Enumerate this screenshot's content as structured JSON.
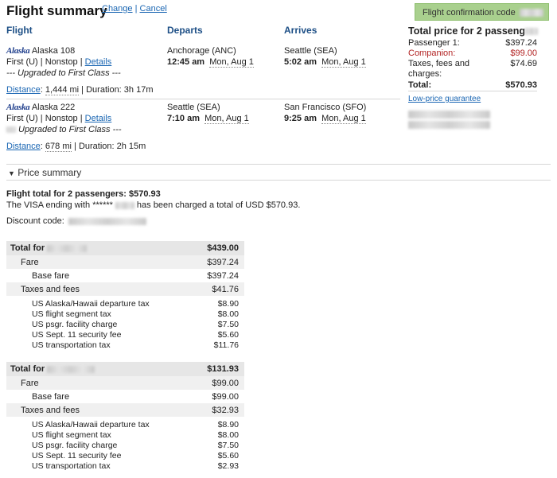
{
  "header": {
    "title": "Flight summary",
    "change": "Change",
    "sep": "|",
    "cancel": "Cancel",
    "confirmation_label": "Flight confirmation code"
  },
  "columns": {
    "flight": "Flight",
    "departs": "Departs",
    "arrives": "Arrives"
  },
  "segments": [
    {
      "logo": "Alaska",
      "flight": "Alaska 108",
      "cabin": "First (U)",
      "stops": "Nonstop",
      "details": "Details",
      "upgrade": "--- Upgraded to First Class ---",
      "dep_city": "Anchorage (ANC)",
      "dep_time": "12:45 am",
      "dep_date": "Mon, Aug 1",
      "arr_city": "Seattle (SEA)",
      "arr_time": "5:02 am",
      "arr_date": "Mon, Aug 1",
      "distance_label": "Distance",
      "distance": "1,444 mi",
      "duration": "Duration: 3h 17m"
    },
    {
      "logo": "Alaska",
      "flight": "Alaska 222",
      "cabin": "First (U)",
      "stops": "Nonstop",
      "details": "Details",
      "upgrade": "Upgraded to First Class ---",
      "dep_city": "Seattle (SEA)",
      "dep_time": "7:10 am",
      "dep_date": "Mon, Aug 1",
      "arr_city": "San Francisco (SFO)",
      "arr_time": "9:25 am",
      "arr_date": "Mon, Aug 1",
      "distance_label": "Distance",
      "distance": "678 mi",
      "duration": "Duration: 2h 15m"
    }
  ],
  "price_box": {
    "title": "Total price for 2 passeng",
    "rows": [
      {
        "label": "Passenger 1:",
        "value": "$397.24"
      },
      {
        "label": "Companion:",
        "value": "$99.00"
      },
      {
        "label": "Taxes, fees and",
        "value": "$74.69"
      },
      {
        "label": "charges:",
        "value": ""
      },
      {
        "label": "Total:",
        "value": "$570.93"
      }
    ],
    "guarantee": "Low-price guarantee"
  },
  "price_summary": {
    "toggle": "▼",
    "label": "Price summary",
    "flight_total": "Flight total for 2 passengers: $570.93",
    "visa_pre": "The VISA ending with ******",
    "visa_post": "has been charged a total of USD $570.93.",
    "discount_label": "Discount code:"
  },
  "tables": [
    {
      "total_label": "Total for",
      "total": "$439.00",
      "fare_label": "Fare",
      "fare": "$397.24",
      "base_label": "Base fare",
      "base": "$397.24",
      "taxes_label": "Taxes and fees",
      "taxes": "$41.76",
      "tax_items": [
        {
          "label": "US Alaska/Hawaii departure tax",
          "value": "$8.90"
        },
        {
          "label": "US flight segment tax",
          "value": "$8.00"
        },
        {
          "label": "US psgr. facility charge",
          "value": "$7.50"
        },
        {
          "label": "US Sept. 11 security fee",
          "value": "$5.60"
        },
        {
          "label": "US transportation tax",
          "value": "$11.76"
        }
      ]
    },
    {
      "total_label": "Total for",
      "total": "$131.93",
      "fare_label": "Fare",
      "fare": "$99.00",
      "base_label": "Base fare",
      "base": "$99.00",
      "taxes_label": "Taxes and fees",
      "taxes": "$32.93",
      "tax_items": [
        {
          "label": "US Alaska/Hawaii departure tax",
          "value": "$8.90"
        },
        {
          "label": "US flight segment tax",
          "value": "$8.00"
        },
        {
          "label": "US psgr. facility charge",
          "value": "$7.50"
        },
        {
          "label": "US Sept. 11 security fee",
          "value": "$5.60"
        },
        {
          "label": "US transportation tax",
          "value": "$2.93"
        }
      ]
    }
  ]
}
